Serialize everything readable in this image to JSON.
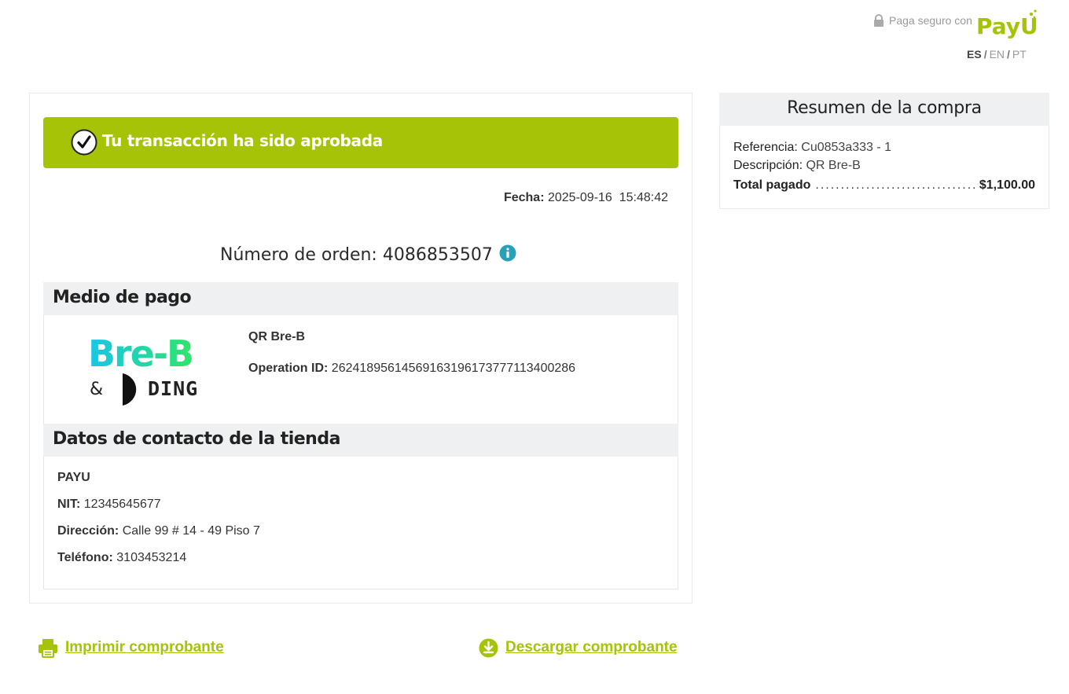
{
  "header": {
    "secure_text": "Paga seguro con",
    "brand_logo_text": "PayU",
    "languages": [
      {
        "code": "ES",
        "active": true
      },
      {
        "code": "EN",
        "active": false
      },
      {
        "code": "PT",
        "active": false
      }
    ],
    "lang_separator": "/"
  },
  "status": {
    "message": "Tu transacción ha sido aprobada",
    "color": "#a6c307"
  },
  "fecha": {
    "label": "Fecha:",
    "value": "2025-09-16  15:48:42"
  },
  "order": {
    "label": "Número de orden:",
    "value": "4086853507"
  },
  "payment_method": {
    "section_title": "Medio de pago",
    "logo_text_primary": "Bre-B",
    "logo_ampersand": "&",
    "logo_text_secondary": "DING",
    "name": "QR Bre-B",
    "operation_label": "Operation ID:",
    "operation_id": "26241895614569163196173777113400286"
  },
  "store_contact": {
    "section_title": "Datos de contacto de la tienda",
    "name": "PAYU",
    "nit_label": "NIT:",
    "nit": "12345645677",
    "address_label": "Dirección:",
    "address": "Calle 99 # 14 - 49 Piso 7",
    "phone_label": "Teléfono:",
    "phone": "3103453214"
  },
  "summary": {
    "title": "Resumen de la compra",
    "reference_label": "Referencia:",
    "reference": "Cu0853a333 - 1",
    "description_label": "Descripción:",
    "description": "QR Bre-B",
    "total_label": "Total pagado",
    "total": "$1,100.00"
  },
  "actions": {
    "print_label": "Imprimir comprobante",
    "download_label": "Descargar comprobante"
  },
  "colors": {
    "accent": "#a6c307",
    "section_bg": "#eef0f1",
    "info_icon": "#2aa0b8"
  }
}
